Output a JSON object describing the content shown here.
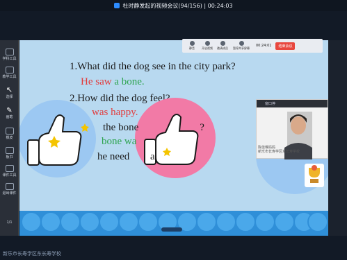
{
  "titlebar": {
    "title": "杜时静发起的视频会议(94/156) | 00:24:03"
  },
  "sidebar": {
    "items": [
      {
        "label": "学科工具"
      },
      {
        "label": "教学工具"
      },
      {
        "label": "选择"
      },
      {
        "label": "画笔"
      },
      {
        "label": "橡皮"
      },
      {
        "label": "板书"
      },
      {
        "label": "课件工具"
      },
      {
        "label": "退出课件"
      },
      {
        "label": "1/1"
      }
    ]
  },
  "slide": {
    "q1": "1.What  did the dog  see in the city park?",
    "a1": {
      "w1": "He",
      "w2": "saw",
      "w3": "a",
      "w4": "bone."
    },
    "q2": "2.How did the dog feel?",
    "a2": {
      "w1": "was",
      "w2": "happy."
    },
    "a3": {
      "w1": "the bone",
      "w2": "?"
    },
    "a4": {
      "w1": "bone",
      "w2": "wa"
    },
    "a5": {
      "w1": "he  need",
      "w2": "a"
    }
  },
  "toolbar": {
    "buttons": [
      "静音",
      "开启视频",
      "邀请成员",
      "暂停共享屏幕"
    ],
    "timer": "00:24:01",
    "end_label": "结束会议"
  },
  "video": {
    "header": "窗口停",
    "caption1": "陈佳琳妈妈",
    "caption2": "新乐市长寿学区东长寿学校"
  },
  "watermark": "新乐市长寿学区东长寿学校",
  "colors": {
    "red": "#e23b3b",
    "green": "#2ea44f",
    "slide_bg": "#b8d9f0"
  }
}
